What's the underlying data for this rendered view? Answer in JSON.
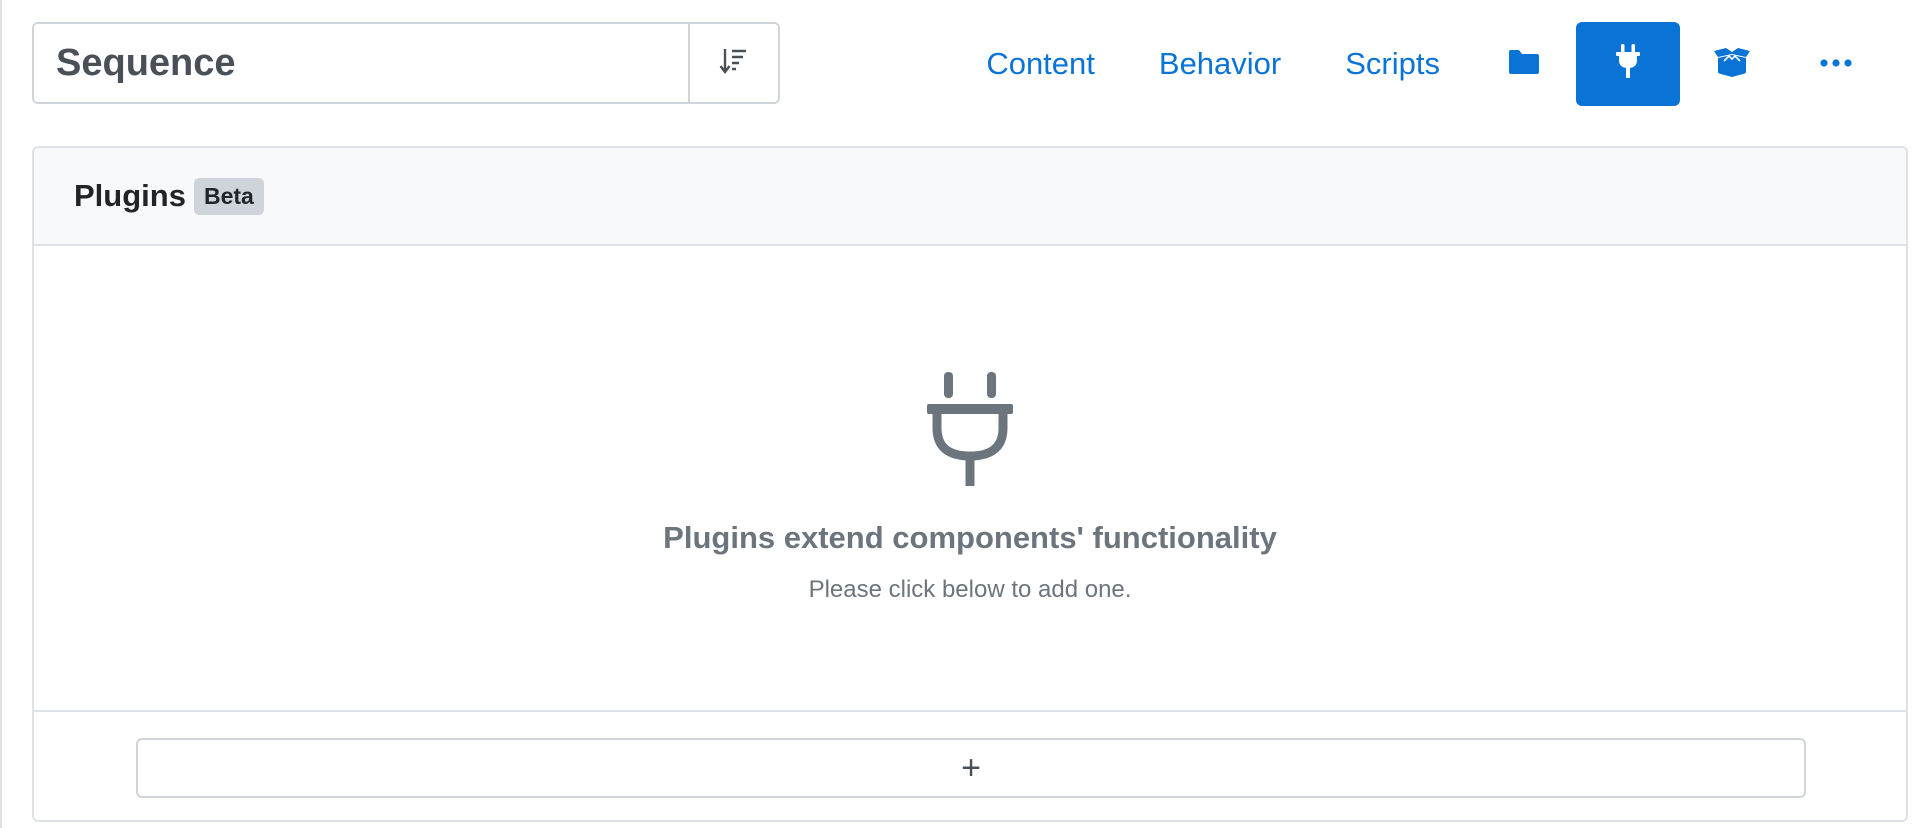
{
  "toolbar": {
    "title_value": "Sequence",
    "sort_icon": "sort-descending-icon"
  },
  "nav": {
    "links": [
      "Content",
      "Behavior",
      "Scripts"
    ],
    "icons": [
      {
        "name": "folder-icon",
        "active": false
      },
      {
        "name": "plug-icon",
        "active": true
      },
      {
        "name": "open-box-icon",
        "active": false
      },
      {
        "name": "more-horizontal-icon",
        "active": false
      }
    ],
    "accent_color": "#0a74d6"
  },
  "panel": {
    "title": "Plugins",
    "badge": "Beta",
    "empty_icon": "plug-icon",
    "empty_title": "Plugins extend components' functionality",
    "empty_subtitle": "Please click below to add one.",
    "add_label": "+"
  }
}
